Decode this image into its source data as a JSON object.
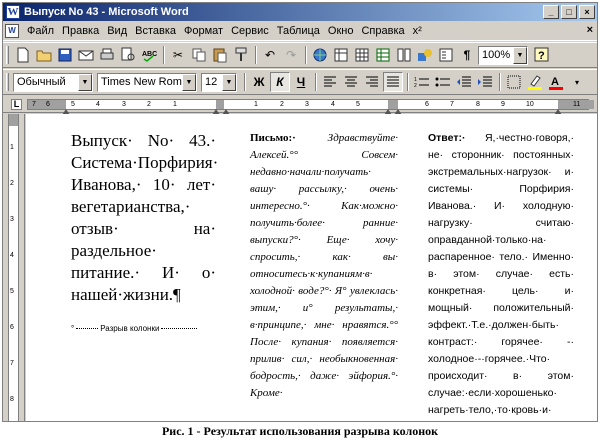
{
  "window": {
    "title": "Выпуск No 43 - Microsoft Word",
    "app_icon_label": "W",
    "min_label": "_",
    "max_label": "□",
    "close_label": "×"
  },
  "menu": {
    "items": [
      "Файл",
      "Правка",
      "Вид",
      "Вставка",
      "Формат",
      "Сервис",
      "Таблица",
      "Окно",
      "Справка",
      "x²"
    ],
    "close_label": "×"
  },
  "toolbar_standard": {
    "zoom_value": "100%"
  },
  "toolbar_formatting": {
    "style_value": "Обычный",
    "font_value": "Times New Roman",
    "size_value": "12",
    "bold_label": "Ж",
    "italic_label": "К",
    "underline_label": "Ч"
  },
  "ruler": {
    "tab_marker": "L",
    "numbers": [
      "7",
      "6",
      "5",
      "4",
      "3",
      "2",
      "1",
      "1",
      "2",
      "3",
      "4",
      "5",
      "6",
      "7",
      "8",
      "9",
      "10",
      "11"
    ]
  },
  "vruler": {
    "numbers": [
      "1",
      "2",
      "3",
      "4",
      "5",
      "6",
      "7",
      "8"
    ]
  },
  "document": {
    "column1_text": "Выпуск· No· 43.· Система·Порфирия· Иванова,· 10· лет· вегетарианства,· отзыв· на· раздельное· питание.· И· о· нашей·жизни.¶",
    "column_break_label": "Разрыв колонки",
    "column2_label": "Письмо:·",
    "column2_text": "Здравствуйте· Алексей.°° Совсем· недавно·начали·получать· вашу· рассылку,· очень· интересно.°· Как·можно· получить·более· ранние· выпуски?°· Еще· хочу· спросить,· как· вы· относитесь·к·купаниям·в· холодной· воде?°· Я° увлеклась· этим,· и° результаты,· в·принципе,· мне· нравятся.°° После· купания· появляется· прилив· сил,· необыкновенная· бодрость,· даже· эйфория.°· Кроме·",
    "column3_label": "Ответ:·",
    "column3_text": "Я,·честно·говоря,· не· сторонник· постоянных· экстремальных·нагрузок· и· системы· Порфирия· Иванова.· И· холодную· нагрузку· считаю· оправданной·только·на· распаренное· тело.· Именно· в· этом· случае· есть· конкретная· цель· и· мощный· положительный· эффект.·Т.е.·должен·быть· контраст:· горячее· -· холодное·-·горячее.·Что· происходит· в· этом· случае:·если·хорошенько· нагреть·тело,·то·кровь·и·"
  },
  "caption": "Рис. 1 - Результат использования разрыва колонок"
}
